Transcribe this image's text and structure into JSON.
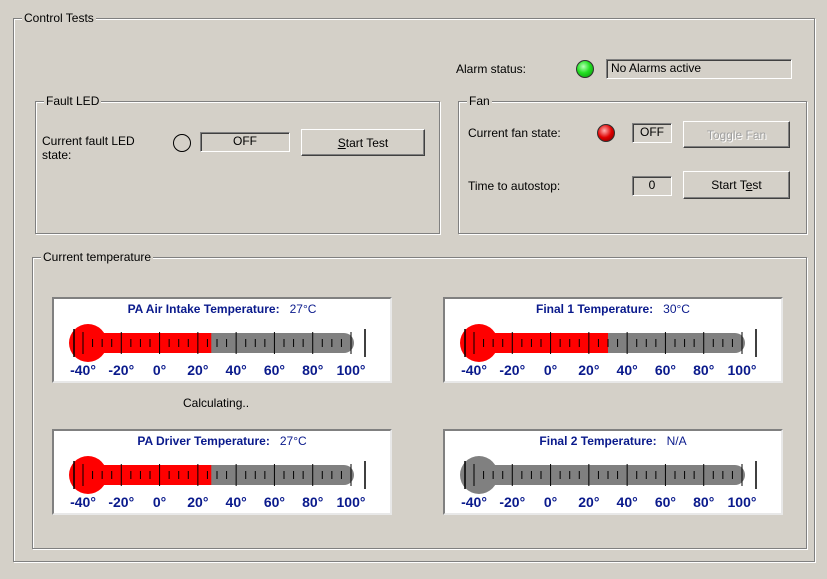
{
  "control_tests": {
    "legend": "Control Tests"
  },
  "alarm": {
    "label": "Alarm status:",
    "value": "No Alarms active",
    "led_color": "#22e022"
  },
  "fault_led": {
    "legend": "Fault LED",
    "label": "Current fault LED state:",
    "value": "OFF",
    "start_test_prefix": "",
    "start_test_mnemonic": "S",
    "start_test_suffix": "tart Test"
  },
  "fan": {
    "legend": "Fan",
    "state_label": "Current fan state:",
    "state_value": "OFF",
    "state_led_color": "#e00000",
    "toggle_label": "Toggle Fan",
    "autostop_label": "Time to autostop:",
    "autostop_value": "0",
    "start_test_prefix": "Start T",
    "start_test_mnemonic": "e",
    "start_test_suffix": "st"
  },
  "temperature": {
    "legend": "Current temperature",
    "calculating": "Calculating..",
    "scale_labels": [
      "-40°",
      "-20°",
      "0°",
      "20°",
      "40°",
      "60°",
      "80°",
      "100°"
    ],
    "scale_min": -40,
    "scale_max": 100,
    "active_color": "#ff0000",
    "inactive_color": "#808080",
    "gauges": [
      {
        "title": "PA Air Intake Temperature:",
        "value_text": "27°C",
        "value": 27,
        "active": true
      },
      {
        "title": "Final 1 Temperature:",
        "value_text": "30°C",
        "value": 30,
        "active": true
      },
      {
        "title": "PA Driver Temperature:",
        "value_text": "27°C",
        "value": 27,
        "active": true
      },
      {
        "title": "Final 2 Temperature:",
        "value_text": "N/A",
        "value": null,
        "active": false
      }
    ]
  }
}
